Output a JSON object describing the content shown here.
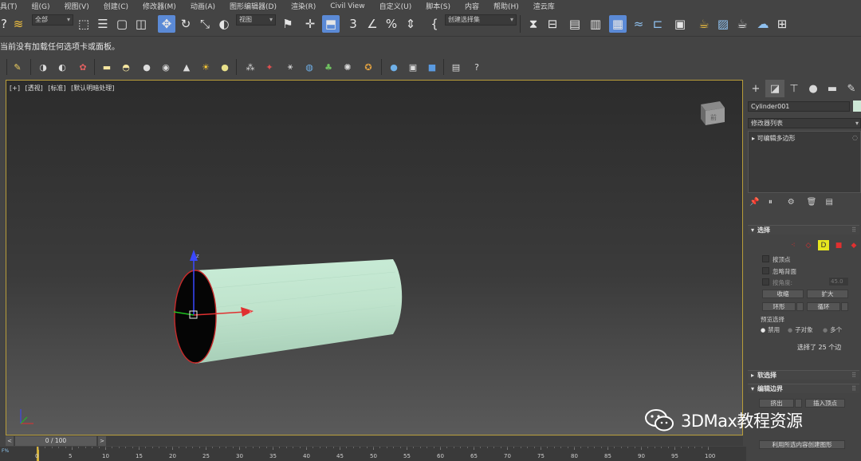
{
  "menu": [
    "具(T)",
    "组(G)",
    "视图(V)",
    "创建(C)",
    "修改器(M)",
    "动画(A)",
    "图形编辑器(D)",
    "渲染(R)",
    "Civil View",
    "自定义(U)",
    "脚本(S)",
    "内容",
    "帮助(H)",
    "渲云库"
  ],
  "toolbar": {
    "filter_value": "全部",
    "ref_coord_value": "视图",
    "named_selection_value": "创建选择集"
  },
  "status_line": "当前没有加载任何选项卡或面板。",
  "viewport": {
    "label_plus": "[+]",
    "label_view": "[透视]",
    "label_shading": "[标准]",
    "label_style": "[默认明暗处理]",
    "object_color": "#c9ecd7",
    "cube_label": "前"
  },
  "command_panel": {
    "object_name": "Cylinder001",
    "object_color": "#cde8d6",
    "modifier_list": "修改器列表",
    "stack_item": "可编辑多边形",
    "rollout_selection": "选择",
    "by_vertex": "按顶点",
    "ignore_backfacing": "忽略背面",
    "by_angle": "按角度:",
    "angle_value": "45.0",
    "shrink": "收缩",
    "grow": "扩大",
    "ring": "环形",
    "loop": "循环",
    "preview_selection": "预览选择",
    "preview_disabled": "禁用",
    "preview_subobject": "子对象",
    "preview_multi": "多个",
    "selection_count": "选择了 25 个边",
    "rollout_soft": "软选择",
    "rollout_edit_borders": "编辑边界",
    "extrude": "挤出",
    "insert_vertex": "插入顶点",
    "create_shape": "利用所选内容创建图形"
  },
  "timeline": {
    "frame_display": "0 / 100",
    "ticks": [
      "0",
      "5",
      "10",
      "15",
      "20",
      "25",
      "30",
      "35",
      "40",
      "45",
      "50",
      "55",
      "60",
      "65",
      "70",
      "75",
      "80",
      "85",
      "90",
      "95",
      "100"
    ]
  },
  "watermark": "3DMax教程资源"
}
